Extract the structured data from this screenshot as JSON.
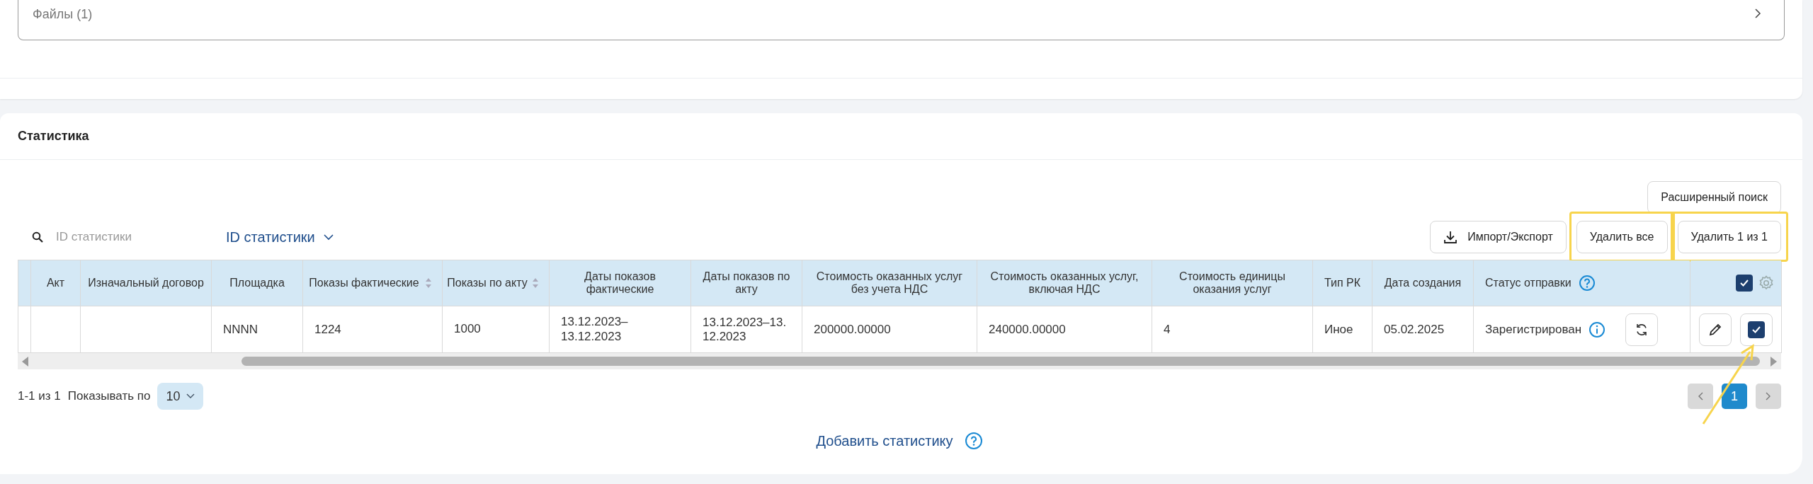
{
  "files_field": {
    "label": "Файлы (1)",
    "expanded": false
  },
  "statistics": {
    "title": "Статистика",
    "advanced_search_button": "Расширенный поиск",
    "search": {
      "placeholder": "ID статистики"
    },
    "search_by": {
      "label": "ID статистики"
    },
    "actions": [
      {
        "kind": "import",
        "label": "Импорт/Экспорт",
        "highlighted": false
      },
      {
        "kind": "plain",
        "label": "Удалить все",
        "highlighted": true
      },
      {
        "kind": "plain",
        "label": "Удалить 1 из 1",
        "highlighted": true
      }
    ],
    "table": {
      "columns": [
        {
          "label": "Акт",
          "sortable": false
        },
        {
          "label": "Изначальный договор",
          "sortable": false
        },
        {
          "label": "Площадка",
          "sortable": false
        },
        {
          "label": "Показы фактические",
          "sortable": true
        },
        {
          "label": "Показы по акту",
          "sortable": true
        },
        {
          "label": "Даты показов фактические",
          "sortable": false
        },
        {
          "label": "Даты показов по акту",
          "sortable": false
        },
        {
          "label": "Стоимость оказанных услуг без учета НДС",
          "sortable": false
        },
        {
          "label": "Стоимость оказанных услуг, включая НДС",
          "sortable": false
        },
        {
          "label": "Стоимость единицы оказания услуг",
          "sortable": false
        },
        {
          "label": "Тип РК",
          "sortable": false
        },
        {
          "label": "Дата создания",
          "sortable": false
        },
        {
          "label": "Статус отправки",
          "sortable": false
        }
      ],
      "select_all": {
        "checked": true
      },
      "rows": [
        {
          "cells": [
            null,
            null,
            "NNNN",
            "1224",
            "1000",
            "13.12.2023–13.12.2023",
            "13.12.2023–13.12.2023",
            "200000.00000",
            "240000.00000",
            "4",
            "Иное",
            "05.02.2025"
          ],
          "status": "Зарегистрирован",
          "checked": true,
          "pointed": true
        }
      ]
    },
    "pagination": {
      "range": "1-1 из 1",
      "page_size_label": "Показывать по",
      "page_size": "10",
      "prev_disabled": true,
      "next_disabled": true,
      "pages": [
        {
          "label": "1",
          "selected": true
        }
      ]
    },
    "add_link": "Добавить статистику"
  }
}
